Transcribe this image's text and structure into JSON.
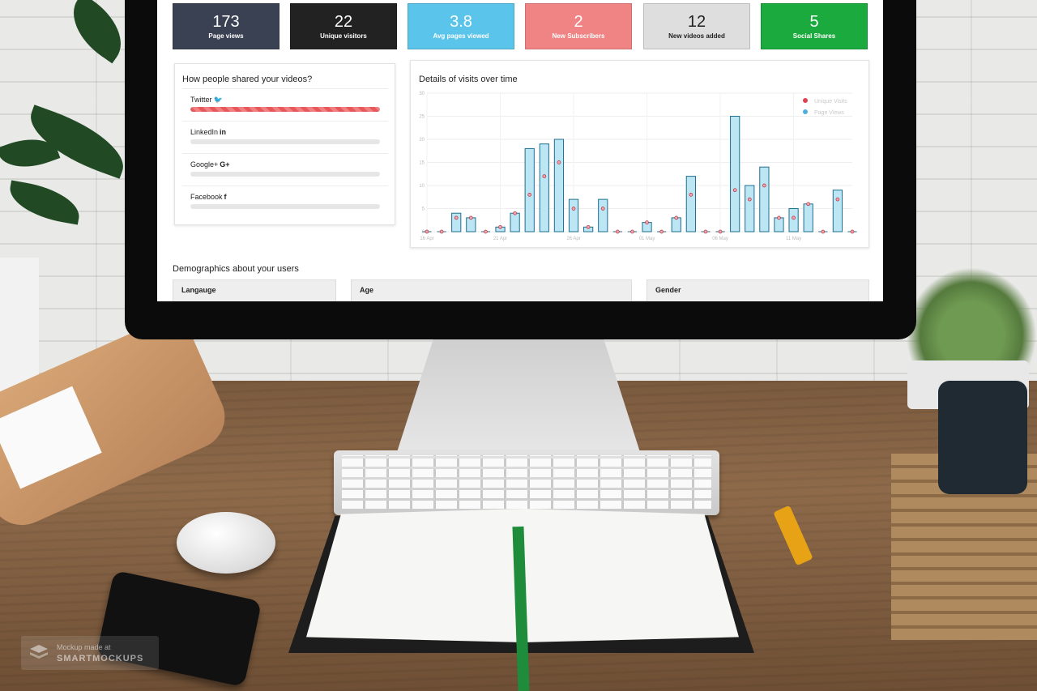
{
  "stats": [
    {
      "value": "173",
      "label": "Page views",
      "color": "#3a4152"
    },
    {
      "value": "22",
      "label": "Unique visitors",
      "color": "#222222"
    },
    {
      "value": "3.8",
      "label": "Avg pages viewed",
      "color": "#5bc4ea"
    },
    {
      "value": "2",
      "label": "New Subscribers",
      "color": "#f08383"
    },
    {
      "value": "12",
      "label": "New videos added",
      "color": "#dedede",
      "text_color": "#222222"
    },
    {
      "value": "5",
      "label": "Social Shares",
      "color": "#1aaa3e"
    }
  ],
  "sharing": {
    "title": "How people shared your videos?",
    "items": [
      {
        "name": "Twitter",
        "icon": "twitter-icon",
        "glyph": "🐦",
        "fraction": 1.0
      },
      {
        "name": "LinkedIn",
        "icon": "linkedin-icon",
        "glyph": "in",
        "fraction": 0.0
      },
      {
        "name": "Google+",
        "icon": "google-plus-icon",
        "glyph": "G+",
        "fraction": 0.0
      },
      {
        "name": "Facebook",
        "icon": "facebook-icon",
        "glyph": "f",
        "fraction": 0.0
      }
    ]
  },
  "chart_data": {
    "type": "bar",
    "title": "Details of visits over time",
    "legend_placement": "top-right",
    "grid": true,
    "ylim": [
      0,
      30
    ],
    "yticks": [
      0,
      5,
      10,
      15,
      20,
      25,
      30
    ],
    "x_tick_labels": [
      "16 Apr",
      "21 Apr",
      "26 Apr",
      "01 May",
      "06 May",
      "11 May"
    ],
    "x_tick_index": [
      0,
      5,
      10,
      15,
      20,
      25
    ],
    "series": [
      {
        "name": "Unique Visits",
        "color": "#e04050",
        "values": [
          0,
          0,
          3,
          3,
          0,
          1,
          4,
          8,
          12,
          15,
          5,
          1,
          5,
          0,
          0,
          2,
          0,
          3,
          8,
          0,
          0,
          9,
          7,
          10,
          3,
          3,
          6,
          0,
          7,
          0
        ]
      },
      {
        "name": "Page Views",
        "color": "#4bb0e0",
        "values": [
          0,
          0,
          4,
          3,
          0,
          1,
          4,
          18,
          19,
          20,
          7,
          1,
          7,
          0,
          0,
          2,
          0,
          3,
          12,
          0,
          0,
          25,
          10,
          14,
          3,
          5,
          6,
          0,
          9,
          0
        ]
      }
    ]
  },
  "demographics": {
    "title": "Demographics about your users",
    "columns": [
      "Langauge",
      "Age",
      "Gender"
    ]
  },
  "watermark": {
    "line1": "Mockup made at",
    "line2": "SMARTMOCKUPS"
  }
}
